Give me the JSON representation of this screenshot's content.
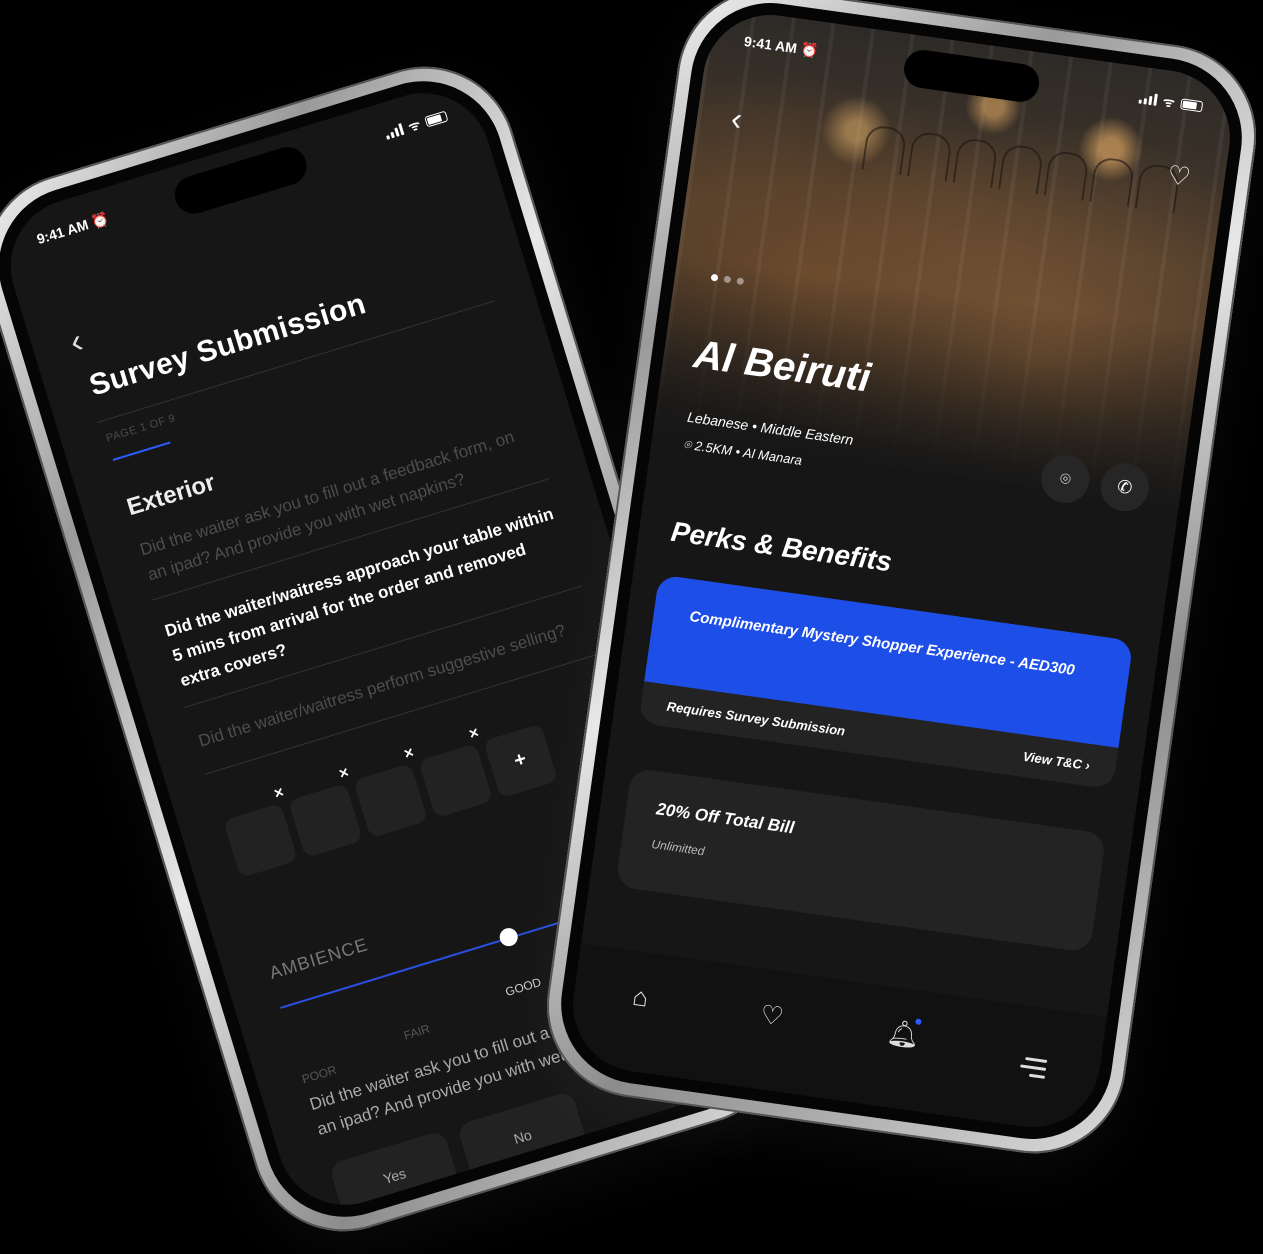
{
  "survey_phone": {
    "status": {
      "time": "9:41 AM ⏰"
    },
    "title": "Survey Submission",
    "page_indicator": "PAGE 1 OF 9",
    "section": "Exterior",
    "questions": [
      "Did the waiter ask you to fill out a feedback form, on an ipad? And provide you with wet napkins?",
      "Did the waiter/waitress approach your table within 5 mins from arrival for the order and removed extra covers?",
      "Did the waiter/waitress perform suggestive selling?",
      "Did the waiter ask you to fill out a feedback form, on an ipad? And provide you with wet napkins?"
    ],
    "photo_slots": {
      "remove_icon": "×",
      "add_icon": "+"
    },
    "ambience": {
      "label": "AMBIENCE",
      "levels": [
        "POOR",
        "FAIR",
        "GOOD"
      ],
      "selected": "GOOD",
      "value_fraction": 0.55
    },
    "answer_buttons": [
      "Yes",
      "No"
    ]
  },
  "restaurant_phone": {
    "status": {
      "time": "9:41 AM ⏰"
    },
    "name": "Al Beiruti",
    "cuisine": "Lebanese • Middle Eastern",
    "location": "⌾ 2.5KM • Al Manara",
    "carousel": {
      "count": 3,
      "active": 0
    },
    "perks_title": "Perks & Benefits",
    "perks": [
      {
        "title": "Complimentary Mystery Shopper Experience - AED300",
        "requirement": "Requires Survey Submission",
        "link": "View T&C ›"
      },
      {
        "title": "20% Off Total Bill",
        "subtitle": "Unlimitted"
      }
    ],
    "tabbar": [
      "home-icon",
      "heart-icon",
      "bell-icon",
      "menu-icon"
    ],
    "colors": {
      "accent": "#1e4ee8"
    }
  }
}
